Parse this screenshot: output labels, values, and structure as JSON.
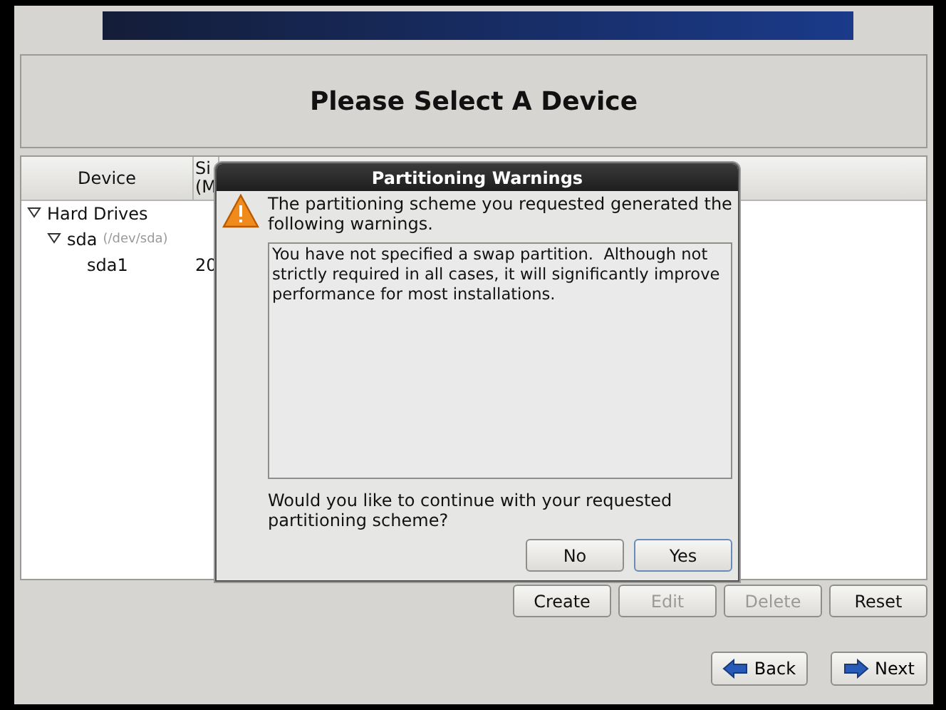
{
  "header": {
    "title": "Please Select A Device"
  },
  "table": {
    "columns": [
      {
        "label": "Device"
      },
      {
        "label": "Si\n(M"
      }
    ],
    "rows": [
      {
        "name": "Hard Drives",
        "expanded": true,
        "children": [
          {
            "name": "sda",
            "path": "(/dev/sda)",
            "expanded": true,
            "children": [
              {
                "name": "sda1",
                "column_2": "20"
              }
            ]
          }
        ]
      }
    ]
  },
  "actions": [
    {
      "label": "Create",
      "disabled": false
    },
    {
      "label": "Edit",
      "disabled": true
    },
    {
      "label": "Delete",
      "disabled": true
    },
    {
      "label": "Reset",
      "disabled": false
    }
  ],
  "navigation": [
    {
      "label": "Back",
      "kind": "back"
    },
    {
      "label": "Next",
      "kind": "next"
    }
  ],
  "dialog": {
    "title": "Partitioning Warnings",
    "intro": "The partitioning scheme you requested generated the following warnings.",
    "warnings": "You have not specified a swap partition.  Although not strictly required in all cases, it will significantly improve performance for most installations.",
    "question": "Would you like to continue with your requested partitioning scheme?",
    "buttons": [
      {
        "label": "No",
        "focused": false
      },
      {
        "label": "Yes",
        "focused": true
      }
    ]
  }
}
